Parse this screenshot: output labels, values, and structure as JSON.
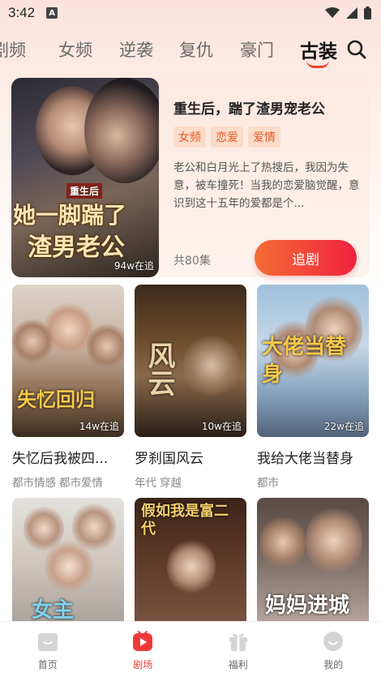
{
  "status_bar": {
    "time": "3:42",
    "app_icon_letter": "A",
    "icons": [
      "wifi-icon",
      "signal-icon",
      "battery-icon"
    ]
  },
  "category_tabs": {
    "items": [
      "剧频",
      "女频",
      "逆袭",
      "复仇",
      "豪门",
      "古装"
    ],
    "active_index": 5
  },
  "featured": {
    "title": "重生后，踹了渣男宠老公",
    "tags": [
      "女频",
      "恋爱",
      "爱情"
    ],
    "description": "老公和白月光上了热搜后，我因为失意，被车撞死！当我的恋爱脑觉醒，意识到这十五年的爱都是个...",
    "episodes": "共80集",
    "follow_label": "追剧",
    "views": "94w在追",
    "cover_label": "重生后",
    "cover_title_line1": "她一脚踹了",
    "cover_title_line2": "渣男老公"
  },
  "grid": [
    {
      "title": "失忆后我被四...",
      "tags": [
        "都市情感",
        "都市爱情"
      ],
      "views": "14w在追",
      "cover_text": "失忆回归"
    },
    {
      "title": "罗刹国风云",
      "tags": [
        "年代",
        "穿越"
      ],
      "views": "10w在追",
      "cover_text": "风云"
    },
    {
      "title": "我给大佬当替身",
      "tags": [
        "都市"
      ],
      "views": "22w在追",
      "cover_text": "大佬当替身"
    },
    {
      "title": "",
      "tags": [],
      "views": "",
      "cover_text": "女主"
    },
    {
      "title": "",
      "tags": [],
      "views": "",
      "cover_text": "假如我是富二代"
    },
    {
      "title": "",
      "tags": [],
      "views": "",
      "cover_text": "妈妈进城"
    }
  ],
  "bottom_nav": {
    "items": [
      {
        "label": "首页",
        "icon": "home-icon"
      },
      {
        "label": "剧场",
        "icon": "theater-icon"
      },
      {
        "label": "福利",
        "icon": "gift-icon"
      },
      {
        "label": "我的",
        "icon": "profile-icon"
      }
    ],
    "active_index": 1
  },
  "colors": {
    "accent": "#f0213f",
    "accent_orange": "#f36c33",
    "tag_bg": "#fbdcc9",
    "tag_text": "#e55a2a"
  }
}
